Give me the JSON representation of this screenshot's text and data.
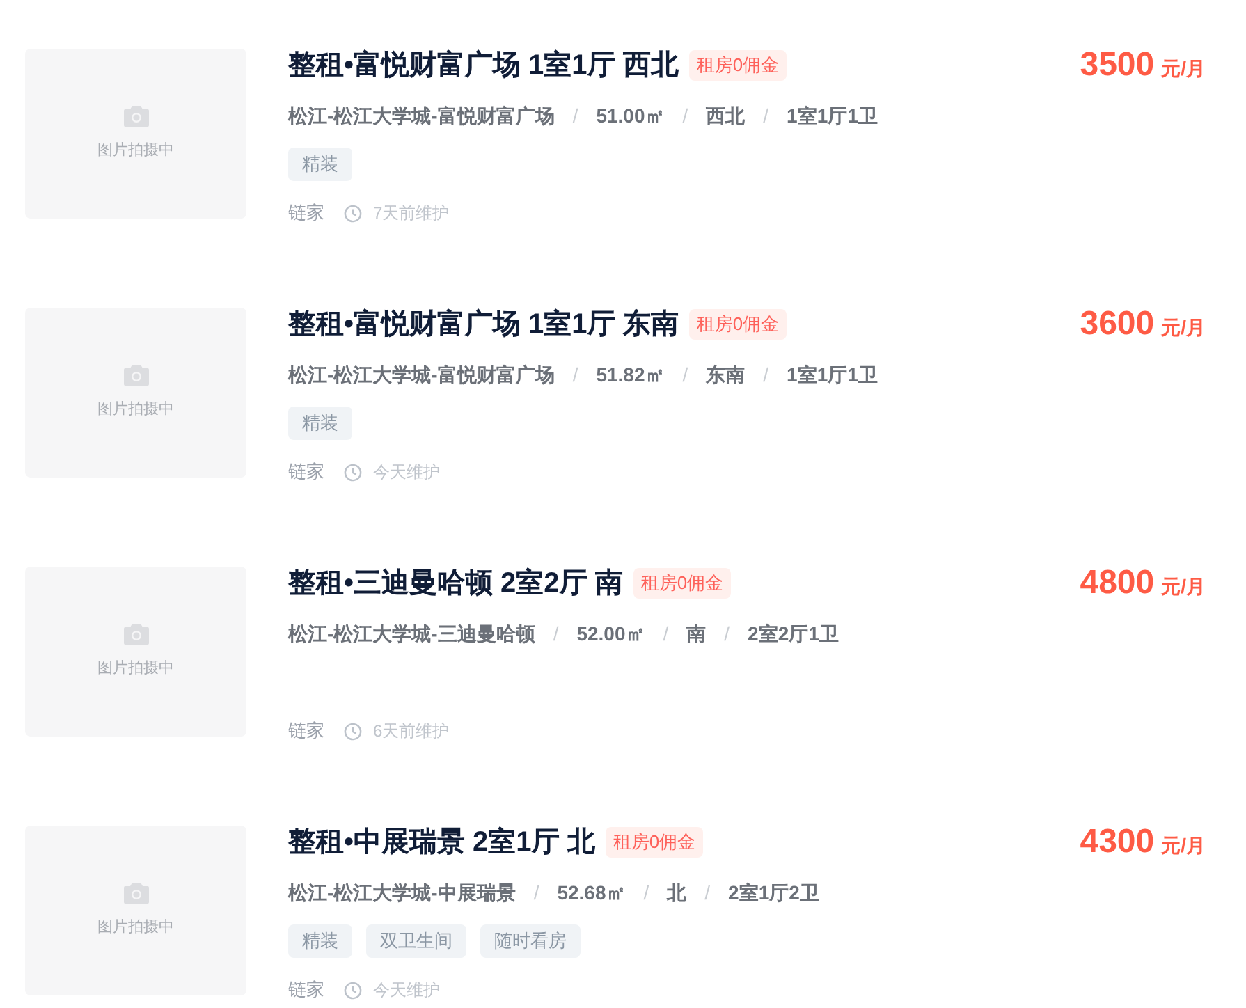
{
  "separator": "/",
  "listings": [
    {
      "placeholder": "图片拍摄中",
      "title": "整租•富悦财富广场 1室1厅 西北",
      "badge": "租房0佣金",
      "price": "3500",
      "unit": "元/月",
      "meta": [
        "松江-松江大学城-富悦财富广场",
        "51.00㎡",
        "西北",
        "1室1厅1卫"
      ],
      "tags": [
        "精装"
      ],
      "agency": "链家",
      "updated": "7天前维护"
    },
    {
      "placeholder": "图片拍摄中",
      "title": "整租•富悦财富广场 1室1厅 东南",
      "badge": "租房0佣金",
      "price": "3600",
      "unit": "元/月",
      "meta": [
        "松江-松江大学城-富悦财富广场",
        "51.82㎡",
        "东南",
        "1室1厅1卫"
      ],
      "tags": [
        "精装"
      ],
      "agency": "链家",
      "updated": "今天维护"
    },
    {
      "placeholder": "图片拍摄中",
      "title": "整租•三迪曼哈顿 2室2厅 南",
      "badge": "租房0佣金",
      "price": "4800",
      "unit": "元/月",
      "meta": [
        "松江-松江大学城-三迪曼哈顿",
        "52.00㎡",
        "南",
        "2室2厅1卫"
      ],
      "agency": "链家",
      "updated": "6天前维护"
    },
    {
      "placeholder": "图片拍摄中",
      "title": "整租•中展瑞景 2室1厅 北",
      "badge": "租房0佣金",
      "price": "4300",
      "unit": "元/月",
      "meta": [
        "松江-松江大学城-中展瑞景",
        "52.68㎡",
        "北",
        "2室1厅2卫"
      ],
      "tags": [
        "精装",
        "双卫生间",
        "随时看房"
      ],
      "agency": "链家",
      "updated": "今天维护"
    }
  ]
}
